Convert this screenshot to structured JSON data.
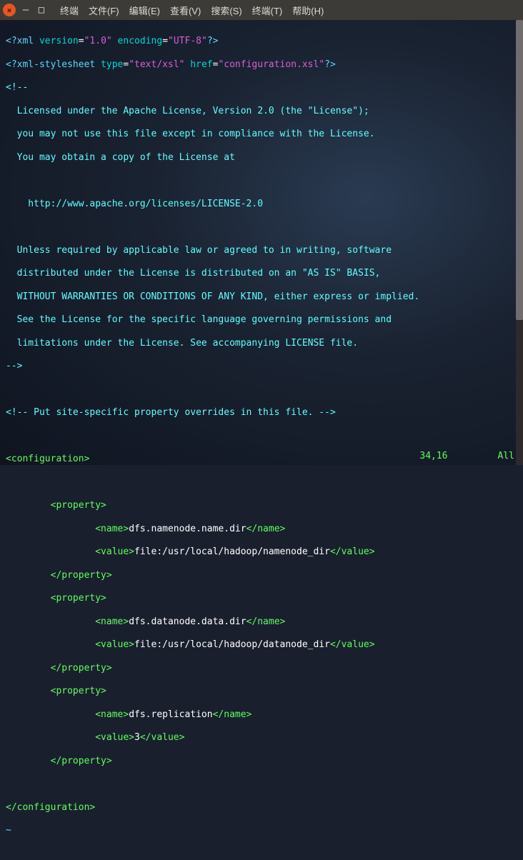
{
  "menu": {
    "terminal": "终端",
    "file": "文件(F)",
    "edit": "编辑(E)",
    "view": "查看(V)",
    "search": "搜索(S)",
    "terminal2": "终端(T)",
    "help": "帮助(H)"
  },
  "xml": {
    "decl_open": "<?xml",
    "version_key": " version",
    "eq": "=",
    "version_val": "\"1.0\"",
    "encoding_key": " encoding",
    "encoding_val": "\"UTF-8\"",
    "decl_close": "?>",
    "stylesheet_open": "<?xml-stylesheet",
    "type_key": " type",
    "type_val": "\"text/xsl\"",
    "href_key": " href",
    "href_val": "\"configuration.xsl\"",
    "comment_open": "<!--",
    "license_l1": "  Licensed under the Apache License, Version 2.0 (the \"License\");",
    "license_l2": "  you may not use this file except in compliance with the License.",
    "license_l3": "  You may obtain a copy of the License at",
    "license_l4": "    http://www.apache.org/licenses/LICENSE-2.0",
    "license_l5": "  Unless required by applicable law or agreed to in writing, software",
    "license_l6": "  distributed under the License is distributed on an \"AS IS\" BASIS,",
    "license_l7": "  WITHOUT WARRANTIES OR CONDITIONS OF ANY KIND, either express or implied.",
    "license_l8": "  See the License for the specific language governing permissions and",
    "license_l9": "  limitations under the License. See accompanying LICENSE file.",
    "comment_close": "-->",
    "site_comment": "<!-- Put site-specific property overrides in this file. -->",
    "config_open": "<configuration>",
    "prop_open": "        <property>",
    "prop_close": "        </property>",
    "name_open": "                <name>",
    "name_close": "</name>",
    "value_open": "                <value>",
    "value_close": "</value>",
    "name1": "dfs.namenode.name.dir",
    "val1": "file:/usr/local/hadoop/namenode_dir",
    "name2": "dfs.datanode.data.dir",
    "val2": "file:/usr/local/hadoop/datanode_dir",
    "name3": "dfs.replication",
    "val3": "3",
    "config_close": "</configuration>",
    "tilde": "~"
  },
  "status": {
    "pos": "34,16",
    "loc": "All"
  }
}
